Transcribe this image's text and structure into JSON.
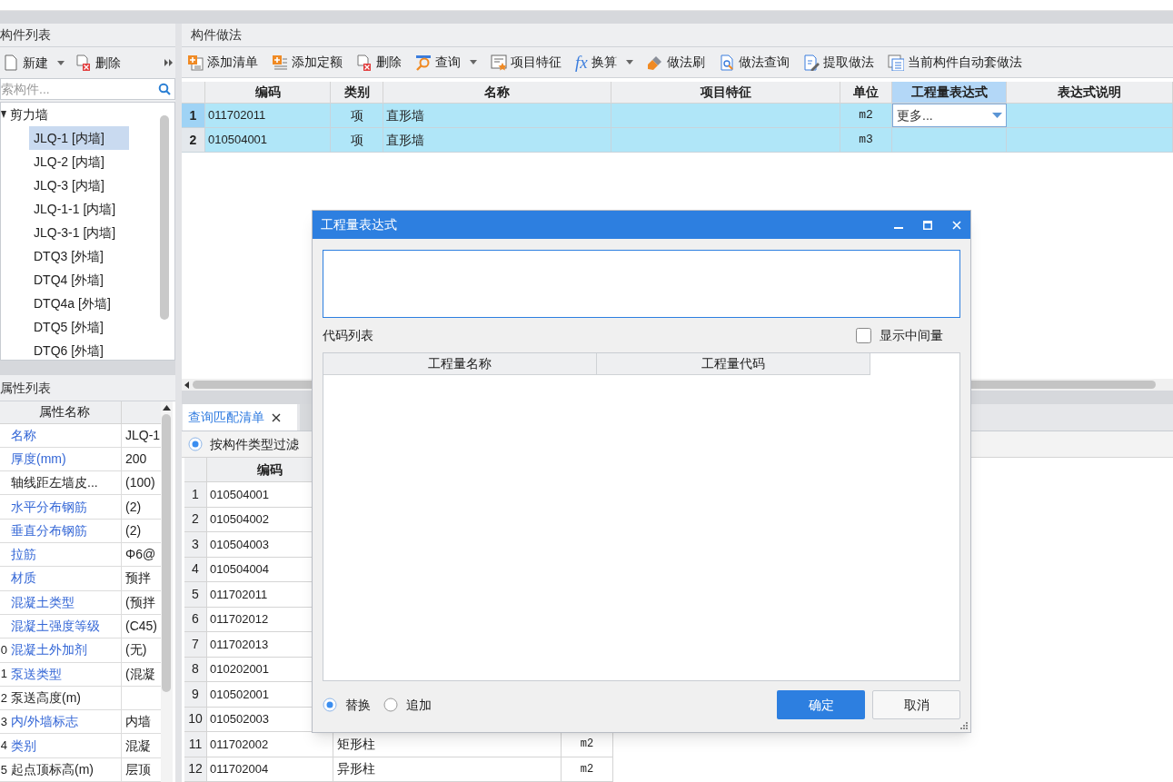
{
  "left_panel": {
    "title": "构件列表",
    "toolbar": [
      {
        "label": "新建",
        "kind": "new",
        "dropdown": true
      },
      {
        "label": "删除",
        "kind": "delete",
        "dropdown": false
      }
    ],
    "search": {
      "placeholder": "索构件..."
    },
    "tree": [
      {
        "label": "剪力墙",
        "expanded": true,
        "children": [
          {
            "label": "JLQ-1 [内墙]",
            "selected": true
          },
          {
            "label": "JLQ-2 [内墙]",
            "selected": false
          },
          {
            "label": "JLQ-3 [内墙]",
            "selected": false
          },
          {
            "label": "JLQ-1-1 [内墙]",
            "selected": false
          },
          {
            "label": "JLQ-3-1 [内墙]",
            "selected": false
          },
          {
            "label": "DTQ3 [外墙]",
            "selected": false
          },
          {
            "label": "DTQ4 [外墙]",
            "selected": false
          },
          {
            "label": "DTQ4a [外墙]",
            "selected": false
          },
          {
            "label": "DTQ5 [外墙]",
            "selected": false
          },
          {
            "label": "DTQ6 [外墙]",
            "selected": false
          }
        ]
      }
    ]
  },
  "properties": {
    "title": "属性列表",
    "columns": [
      "属性名称"
    ],
    "rows": [
      {
        "name": "名称",
        "value": "JLQ-1",
        "common": true
      },
      {
        "name": "厚度(mm)",
        "value": "200",
        "common": true
      },
      {
        "name": "轴线距左墙皮...",
        "value": "(100)",
        "common": false
      },
      {
        "name": "水平分布钢筋",
        "value": "(2)",
        "common": true
      },
      {
        "name": "垂直分布钢筋",
        "value": "(2)",
        "common": true
      },
      {
        "name": "拉筋",
        "value": "Φ6@",
        "common": true
      },
      {
        "name": "材质",
        "value": "预拌",
        "common": true
      },
      {
        "name": "混凝土类型",
        "value": "(预拌",
        "common": true
      },
      {
        "name": "混凝土强度等级",
        "value": "(C45)",
        "common": true
      },
      {
        "num": "0",
        "name": "混凝土外加剂",
        "value": "(无)",
        "common": true
      },
      {
        "num": "1",
        "name": "泵送类型",
        "value": "(混凝",
        "common": true
      },
      {
        "num": "2",
        "name": "泵送高度(m)",
        "common": false
      },
      {
        "num": "3",
        "name": "内/外墙标志",
        "value": "内墙",
        "common": true
      },
      {
        "num": "4",
        "name": "类别",
        "value": "混凝",
        "common": true
      },
      {
        "num": "5",
        "name": "起点顶标高(m)",
        "value": "层顶",
        "common": false
      }
    ]
  },
  "method_panel": {
    "title": "构件做法",
    "toolbar": [
      {
        "label": "添加清单",
        "kind": "add-list",
        "dropdown": false
      },
      {
        "label": "添加定额",
        "kind": "add-quota",
        "dropdown": false
      },
      {
        "label": "删除",
        "kind": "delete",
        "dropdown": false
      },
      {
        "label": "查询",
        "kind": "query",
        "dropdown": true
      },
      {
        "label": "项目特征",
        "kind": "feature",
        "dropdown": false
      },
      {
        "label": "换算",
        "kind": "fx",
        "icon_text": "fx",
        "dropdown": true
      },
      {
        "label": "做法刷",
        "kind": "brush",
        "dropdown": false
      },
      {
        "label": "做法查询",
        "kind": "method-query",
        "dropdown": false
      },
      {
        "label": "提取做法",
        "kind": "extract",
        "dropdown": false
      },
      {
        "label": "当前构件自动套做法",
        "kind": "auto",
        "dropdown": false
      }
    ],
    "table": {
      "columns": [
        {
          "label": "编码",
          "selected": false
        },
        {
          "label": "类别",
          "selected": false
        },
        {
          "label": "名称",
          "selected": false
        },
        {
          "label": "项目特征",
          "selected": false
        },
        {
          "label": "单位",
          "selected": false
        },
        {
          "label": "工程量表达式",
          "selected": true
        },
        {
          "label": "表达式说明",
          "selected": false
        }
      ],
      "rows": [
        {
          "num": "1",
          "code": "011702011",
          "category": "项",
          "name": "直形墙",
          "unit": "m2",
          "expression": "更多...",
          "current": true,
          "selected": true
        },
        {
          "num": "2",
          "code": "010504001",
          "category": "项",
          "name": "直形墙",
          "unit": "m3",
          "current": false,
          "selected": true
        }
      ]
    }
  },
  "bottom_panel": {
    "tabs": [
      {
        "label": "查询匹配清单",
        "selected": true,
        "closable": true
      },
      {
        "selected": false,
        "closable": false
      }
    ],
    "filter": {
      "label": "按构件类型过滤",
      "selected": true
    },
    "table": {
      "columns": [
        "编码"
      ],
      "rows": [
        {
          "num": "1",
          "code": "010504001"
        },
        {
          "num": "2",
          "code": "010504002"
        },
        {
          "num": "3",
          "code": "010504003"
        },
        {
          "num": "4",
          "code": "010504004"
        },
        {
          "num": "5",
          "code": "011702011"
        },
        {
          "num": "6",
          "code": "011702012"
        },
        {
          "num": "7",
          "code": "011702013"
        },
        {
          "num": "8",
          "code": "010202001"
        },
        {
          "num": "9",
          "code": "010502001"
        },
        {
          "num": "10",
          "code": "010502003"
        },
        {
          "num": "11",
          "code": "011702002",
          "name": "矩形柱",
          "unit": "m2"
        },
        {
          "num": "12",
          "code": "011702004",
          "name": "异形柱",
          "unit": "m2"
        }
      ]
    }
  },
  "dialog": {
    "title": "工程量表达式",
    "code_list_label": "代码列表",
    "show_intermediate": {
      "label": "显示中间量",
      "checked": false
    },
    "columns": [
      "工程量名称",
      "工程量代码"
    ],
    "modes": [
      {
        "label": "替换",
        "selected": true
      },
      {
        "label": "追加",
        "selected": false
      }
    ],
    "buttons": [
      {
        "label": "确定",
        "primary": true
      },
      {
        "label": "取消",
        "primary": false
      }
    ]
  }
}
